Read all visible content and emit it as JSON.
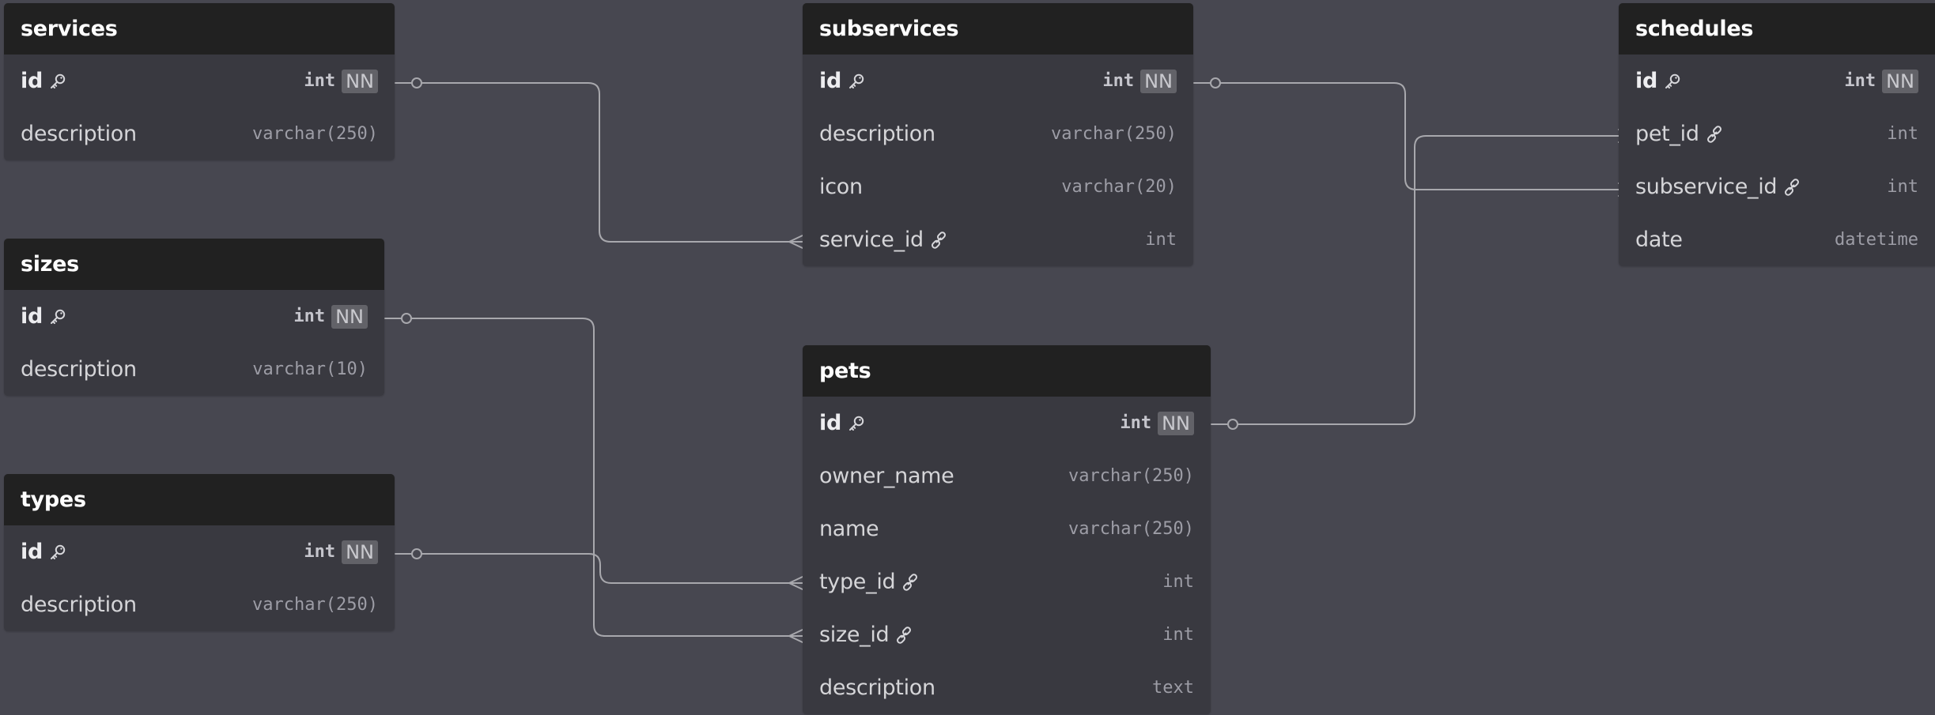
{
  "colors": {
    "canvas": "#474750",
    "table_header": "#212121",
    "table_body": "#393940",
    "connector": "#a8a8ad",
    "nn_badge": "#626268"
  },
  "tables": {
    "services": {
      "name": "services",
      "columns": [
        {
          "name": "id",
          "type": "int",
          "nn": "NN",
          "icon": "key-icon"
        },
        {
          "name": "description",
          "type": "varchar(250)"
        }
      ]
    },
    "sizes": {
      "name": "sizes",
      "columns": [
        {
          "name": "id",
          "type": "int",
          "nn": "NN",
          "icon": "key-icon"
        },
        {
          "name": "description",
          "type": "varchar(10)"
        }
      ]
    },
    "types": {
      "name": "types",
      "columns": [
        {
          "name": "id",
          "type": "int",
          "nn": "NN",
          "icon": "key-icon"
        },
        {
          "name": "description",
          "type": "varchar(250)"
        }
      ]
    },
    "subservices": {
      "name": "subservices",
      "columns": [
        {
          "name": "id",
          "type": "int",
          "nn": "NN",
          "icon": "key-icon"
        },
        {
          "name": "description",
          "type": "varchar(250)"
        },
        {
          "name": "icon",
          "type": "varchar(20)"
        },
        {
          "name": "service_id",
          "type": "int",
          "icon": "link-icon"
        }
      ]
    },
    "pets": {
      "name": "pets",
      "columns": [
        {
          "name": "id",
          "type": "int",
          "nn": "NN",
          "icon": "key-icon"
        },
        {
          "name": "owner_name",
          "type": "varchar(250)"
        },
        {
          "name": "name",
          "type": "varchar(250)"
        },
        {
          "name": "type_id",
          "type": "int",
          "icon": "link-icon"
        },
        {
          "name": "size_id",
          "type": "int",
          "icon": "link-icon"
        },
        {
          "name": "description",
          "type": "text"
        }
      ]
    },
    "schedules": {
      "name": "schedules",
      "columns": [
        {
          "name": "id",
          "type": "int",
          "nn": "NN",
          "icon": "key-icon"
        },
        {
          "name": "pet_id",
          "type": "int",
          "icon": "link-icon"
        },
        {
          "name": "subservice_id",
          "type": "int",
          "icon": "link-icon"
        },
        {
          "name": "date",
          "type": "datetime"
        }
      ]
    }
  },
  "relations": [
    {
      "from": "services.id",
      "to": "subservices.service_id",
      "cardinality": "one-to-many"
    },
    {
      "from": "sizes.id",
      "to": "pets.size_id",
      "cardinality": "one-to-many"
    },
    {
      "from": "types.id",
      "to": "pets.type_id",
      "cardinality": "one-to-many"
    },
    {
      "from": "subservices.id",
      "to": "schedules.subservice_id",
      "cardinality": "one-to-many"
    },
    {
      "from": "pets.id",
      "to": "schedules.pet_id",
      "cardinality": "one-to-many"
    }
  ]
}
